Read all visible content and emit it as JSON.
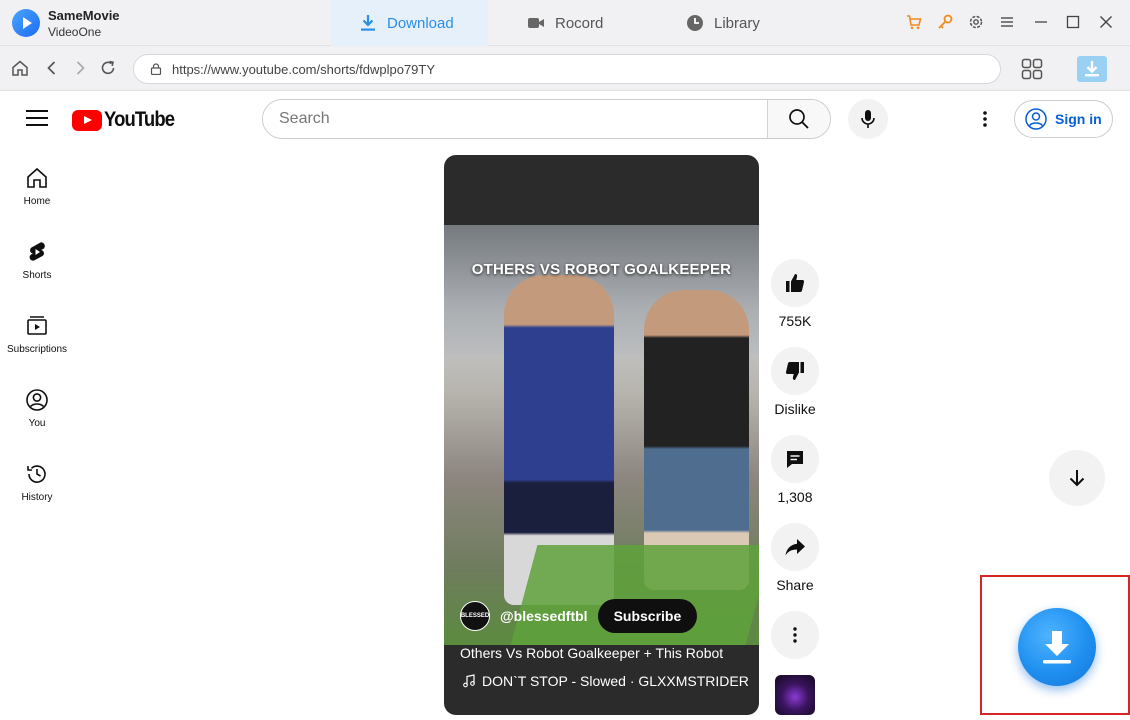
{
  "app": {
    "name": "SameMovie",
    "subtitle": "VideoOne",
    "tabs": [
      {
        "label": "Download",
        "icon": "download-icon",
        "active": true
      },
      {
        "label": "Rocord",
        "icon": "video-camera-icon",
        "active": false
      },
      {
        "label": "Library",
        "icon": "clock-icon",
        "active": false
      }
    ],
    "accent_color": "#2b8ee8",
    "window_controls": [
      "cart-icon",
      "key-icon",
      "gear-icon",
      "menu-icon",
      "minimize-icon",
      "maximize-icon",
      "close-icon"
    ]
  },
  "browser": {
    "url": "https://www.youtube.com/shorts/fdwplpo79TY"
  },
  "youtube": {
    "logo_text": "YouTube",
    "search_placeholder": "Search",
    "sign_in": "Sign in",
    "sidebar": [
      {
        "label": "Home",
        "icon": "home-icon"
      },
      {
        "label": "Shorts",
        "icon": "shorts-icon"
      },
      {
        "label": "Subscriptions",
        "icon": "subscriptions-icon"
      },
      {
        "label": "You",
        "icon": "user-circle-icon"
      },
      {
        "label": "History",
        "icon": "history-icon"
      }
    ],
    "short": {
      "overlay_title": "OTHERS VS ROBOT GOALKEEPER",
      "channel_avatar_text": "BLESSED",
      "channel_handle": "@blessedftbl",
      "subscribe": "Subscribe",
      "caption": "Others Vs Robot Goalkeeper + This Robot",
      "music": "DON`T STOP - Slowed · GLXXMSTRIDER"
    },
    "actions": {
      "likes": "755K",
      "dislike": "Dislike",
      "comments": "1,308",
      "share": "Share"
    }
  },
  "highlight_color": "#d62626"
}
